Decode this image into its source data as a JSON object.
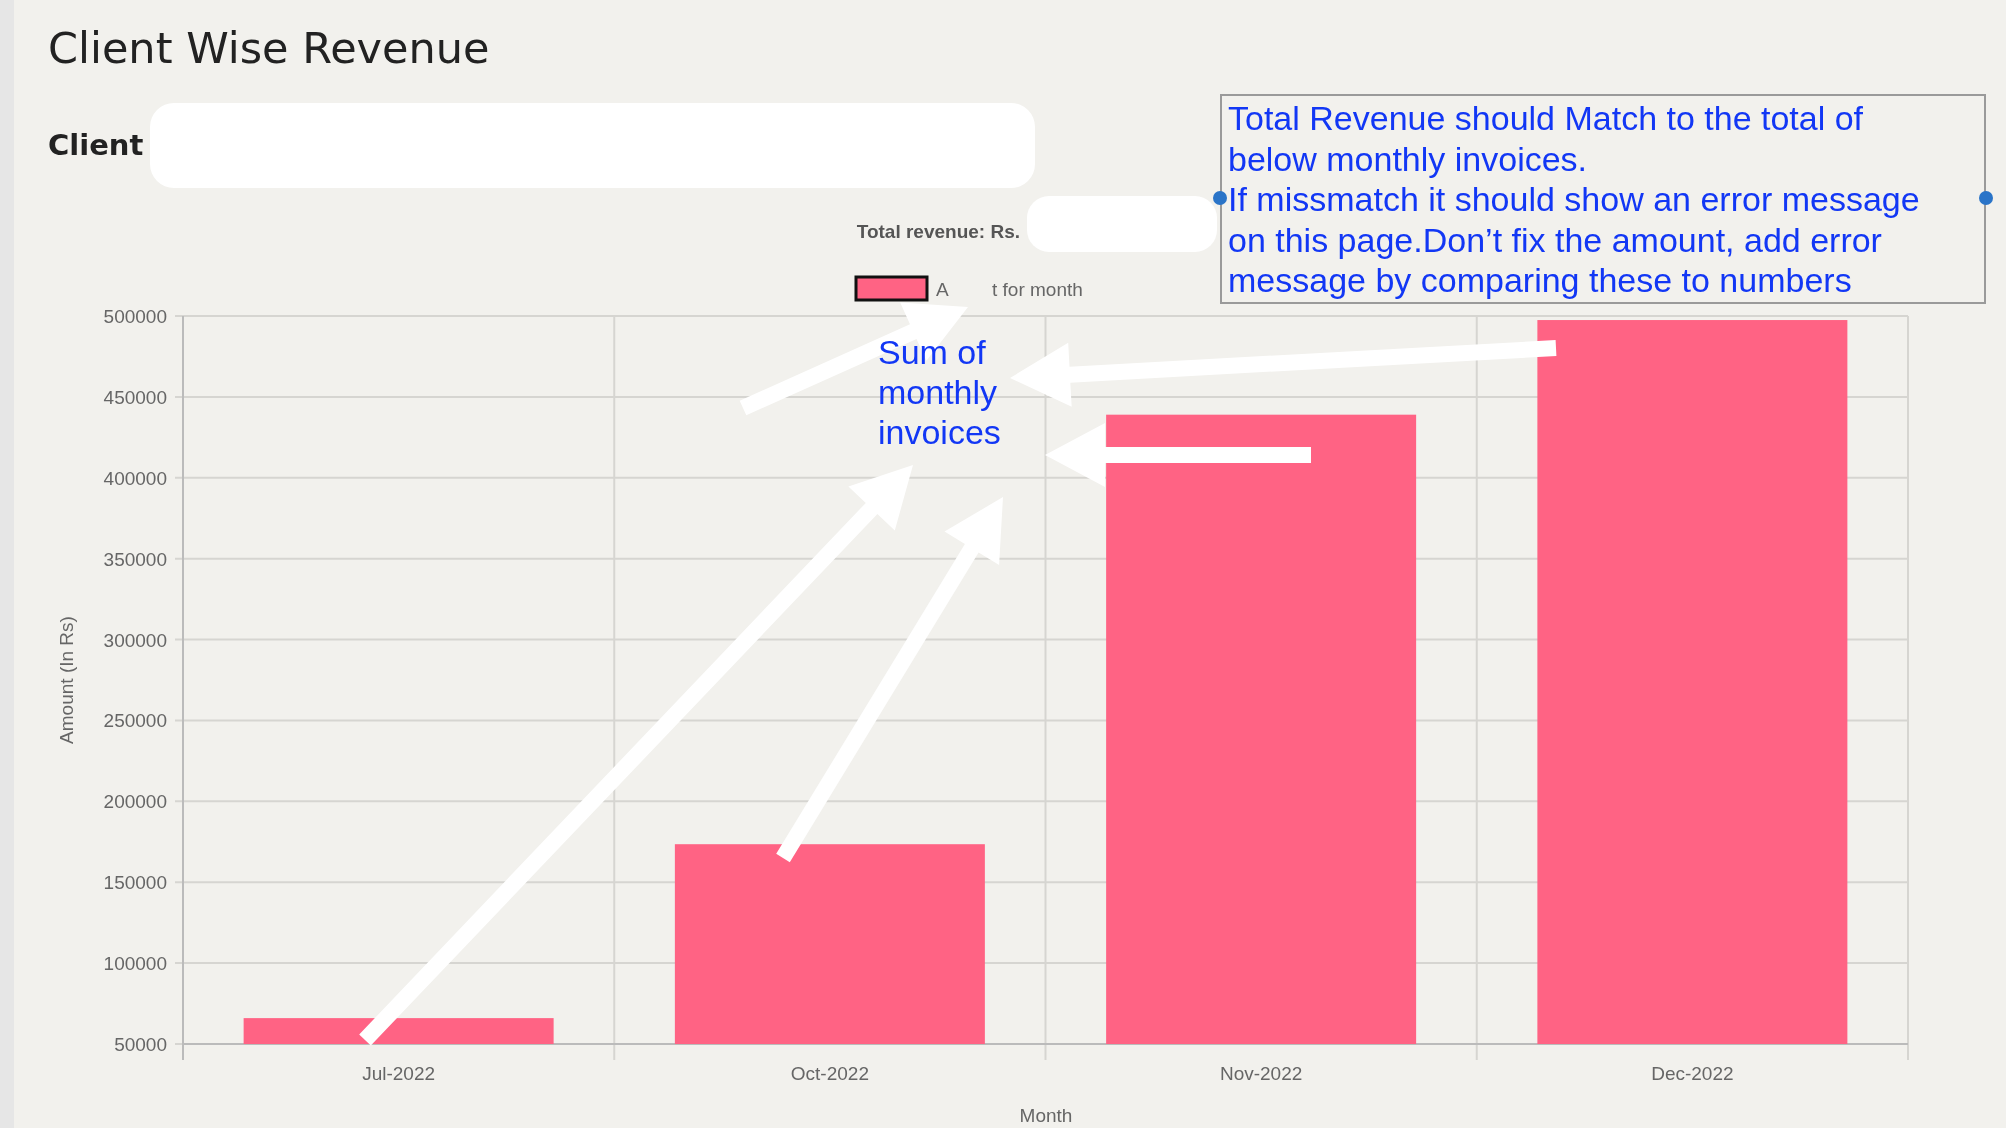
{
  "page": {
    "title": "Client Wise Revenue"
  },
  "client_filter": {
    "label": "Client"
  },
  "total_revenue": {
    "label": "Total revenue: Rs."
  },
  "legend": {
    "parts": [
      "A",
      "t for month"
    ]
  },
  "chart": {
    "chart_data": {
      "type": "bar",
      "xlabel": "Month",
      "ylabel": "Amount (In Rs)",
      "categories": [
        "Jul-2022",
        "Oct-2022",
        "Nov-2022",
        "Dec-2022"
      ],
      "series": [
        {
          "color": "#ff6384",
          "values": [
            66000,
            173500,
            439000,
            497500
          ]
        }
      ],
      "grid": true,
      "ylim": [
        50000,
        500000
      ],
      "yticks": [
        50000,
        100000,
        150000,
        200000,
        250000,
        300000,
        350000,
        400000,
        450000,
        500000
      ]
    }
  },
  "annotation": {
    "note_lines": [
      "Total Revenue should Match to the total of",
      "below monthly invoices.",
      "If missmatch it should show an error message",
      "on this page.Don’t fix the amount, add error",
      "message by comparing these to numbers"
    ],
    "callout_lines": [
      "Sum of",
      "monthly",
      "invoices"
    ]
  }
}
